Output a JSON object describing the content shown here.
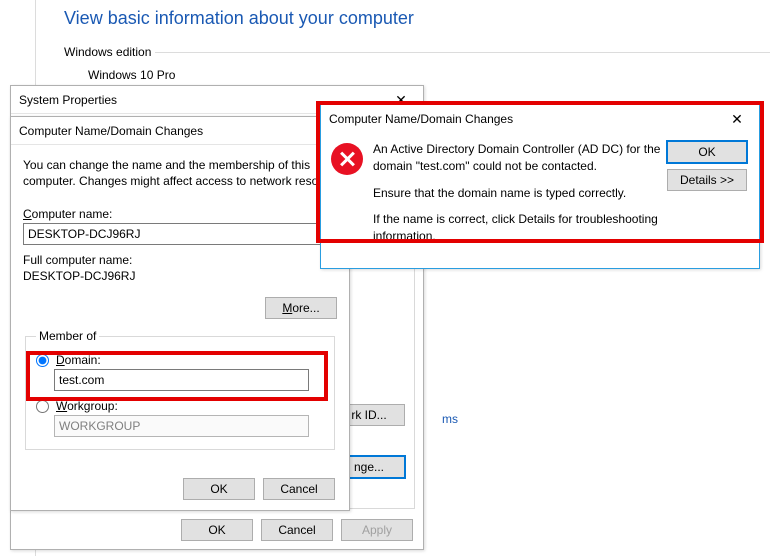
{
  "bg": {
    "heading": "View basic information about your computer",
    "section": "Windows edition",
    "sub": "Windows 10 Pro",
    "right_link": "ms"
  },
  "sysprops": {
    "title": "System Properties",
    "netid_btn": "rk ID...",
    "change_btn": "nge...",
    "ok": "OK",
    "cancel": "Cancel",
    "apply": "Apply"
  },
  "domchg": {
    "title": "Computer Name/Domain Changes",
    "desc": "You can change the name and the membership of this computer. Changes might affect access to network resour",
    "comp_label": "Computer name:",
    "comp_value": "DESKTOP-DCJ96RJ",
    "full_label": "Full computer name:",
    "full_value": "DESKTOP-DCJ96RJ",
    "more": "More...",
    "member_legend": "Member of",
    "domain_label": "Domain:",
    "domain_value": "test.com",
    "workgroup_label": "Workgroup:",
    "workgroup_value": "WORKGROUP",
    "ok": "OK",
    "cancel": "Cancel"
  },
  "err": {
    "title": "Computer Name/Domain Changes",
    "p1": "An Active Directory Domain Controller (AD DC) for the domain \"test.com\" could not be contacted.",
    "p2": "Ensure that the domain name is typed correctly.",
    "p3": "If the name is correct, click Details for troubleshooting information.",
    "ok": "OK",
    "details": "Details >>"
  }
}
